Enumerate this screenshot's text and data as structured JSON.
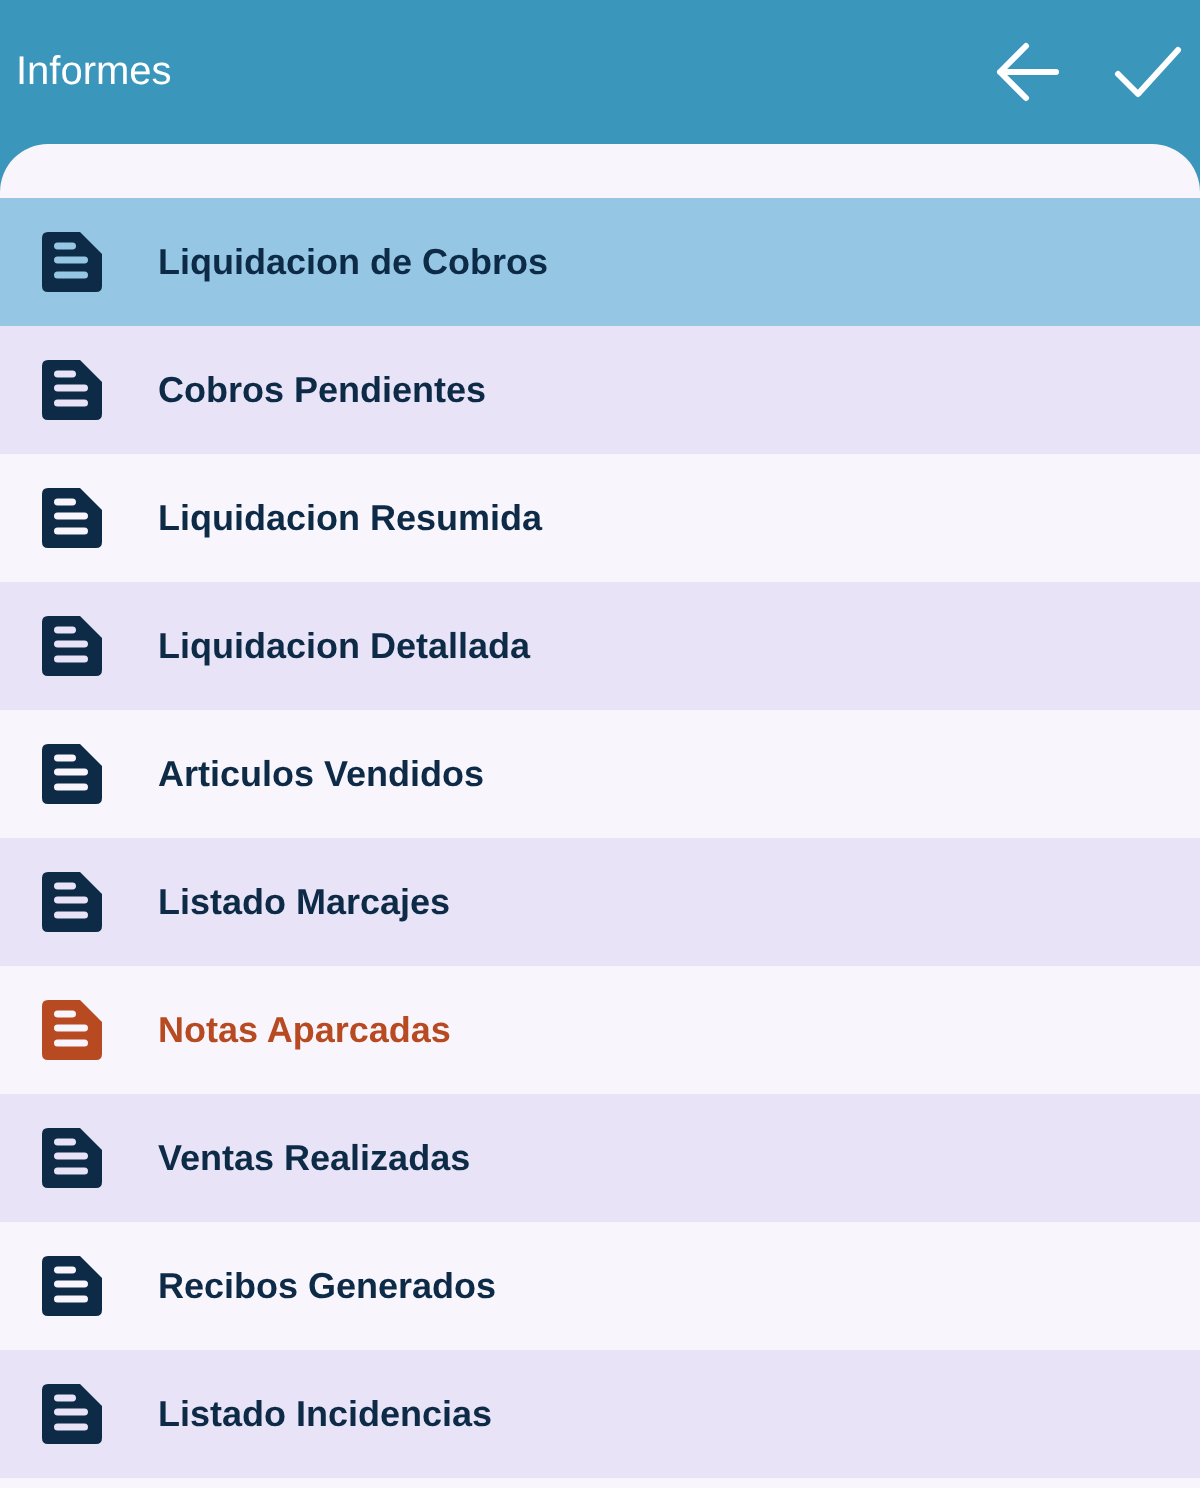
{
  "app_bar": {
    "title": "Informes"
  },
  "reports": [
    {
      "label": "Liquidacion de Cobros",
      "selected": true,
      "color": "#0d2a47"
    },
    {
      "label": "Cobros Pendientes",
      "selected": false,
      "color": "#0d2a47"
    },
    {
      "label": "Liquidacion Resumida",
      "selected": false,
      "color": "#0d2a47"
    },
    {
      "label": "Liquidacion Detallada",
      "selected": false,
      "color": "#0d2a47"
    },
    {
      "label": "Articulos Vendidos",
      "selected": false,
      "color": "#0d2a47"
    },
    {
      "label": "Listado Marcajes",
      "selected": false,
      "color": "#0d2a47"
    },
    {
      "label": "Notas Aparcadas",
      "selected": false,
      "color": "#b84a22"
    },
    {
      "label": "Ventas Realizadas",
      "selected": false,
      "color": "#0d2a47"
    },
    {
      "label": "Recibos Generados",
      "selected": false,
      "color": "#0d2a47"
    },
    {
      "label": "Listado Incidencias",
      "selected": false,
      "color": "#0d2a47"
    }
  ]
}
